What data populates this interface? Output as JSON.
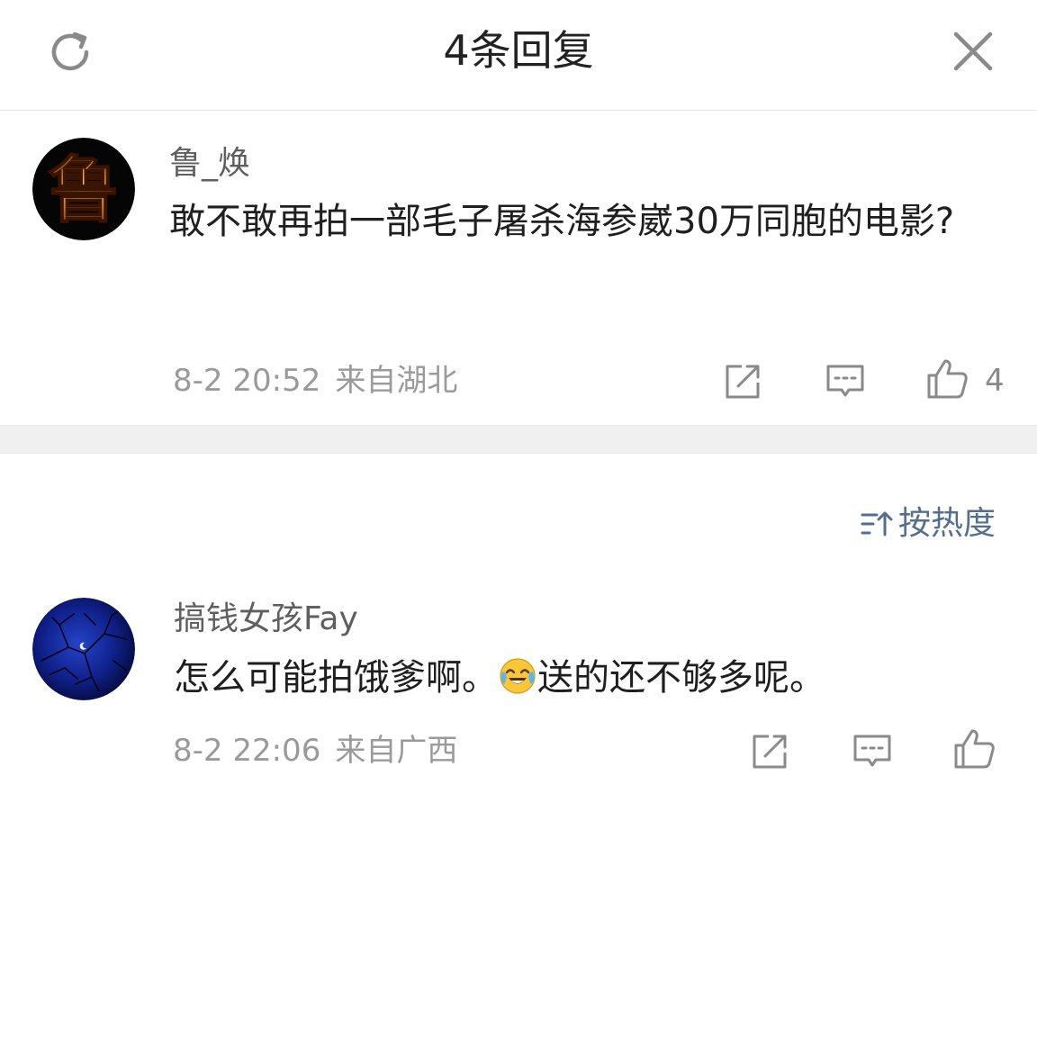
{
  "header": {
    "title": "4条回复",
    "refresh_icon": "refresh-icon",
    "close_icon": "close-icon"
  },
  "root_comment": {
    "username": "鲁_焕",
    "avatar_text": "鲁",
    "content": "敢不敢再拍一部毛子屠杀海参崴30万同胞的电影?",
    "date": "8-2 20:52",
    "location": "来自湖北",
    "like_count": "4",
    "actions": [
      "share-icon",
      "comment-icon",
      "like-icon"
    ]
  },
  "sort": {
    "label": "按热度",
    "icon": "sort-icon"
  },
  "replies": [
    {
      "username": "搞钱女孩Fay",
      "content_before_emoji": "怎么可能拍饿爹啊。",
      "emoji": "laughing-crying-emoji",
      "content_after_emoji": "送的还不够多呢。",
      "date": "8-2 22:06",
      "location": "来自广西",
      "like_count": "",
      "actions": [
        "share-icon",
        "comment-icon",
        "like-icon"
      ]
    }
  ],
  "colors": {
    "username": "#5f5f5f",
    "meta": "#9a9a9a",
    "sort_label": "#546e8f",
    "band": "#f0f0f0"
  }
}
